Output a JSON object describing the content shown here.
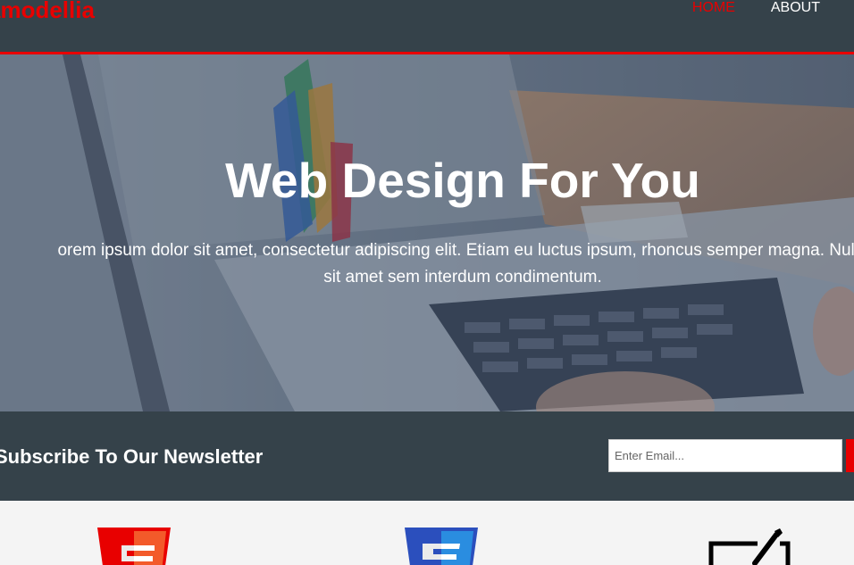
{
  "header": {
    "brand": "amodellia",
    "nav": [
      {
        "label": "HOME",
        "active": true
      },
      {
        "label": "ABOUT",
        "active": false
      }
    ]
  },
  "showcase": {
    "title": "Web Design For You",
    "text_line1": "orem ipsum dolor sit amet, consectetur adipiscing elit. Etiam eu luctus ipsum, rhoncus semper magna. Nulla",
    "text_line2": "sit amet sem interdum condimentum."
  },
  "newsletter": {
    "title": "Subscribe To Our Newsletter",
    "email_placeholder": "Enter Email...",
    "email_value": ""
  },
  "boxes": {
    "icons": [
      "html5-icon",
      "css3-icon",
      "brush-icon"
    ]
  },
  "colors": {
    "brand": "#e80000",
    "dark": "#35424a",
    "light": "#f4f4f4",
    "html5": "#e34f26",
    "css3": "#1572b6"
  }
}
